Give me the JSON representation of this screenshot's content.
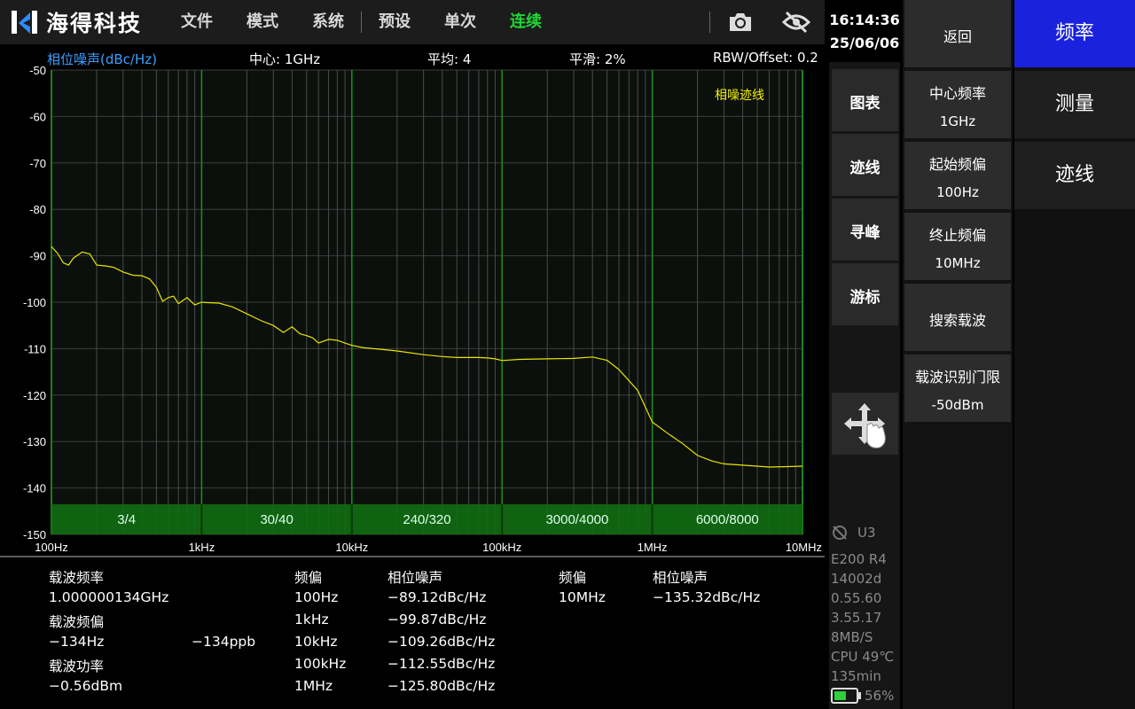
{
  "app": {
    "logo_text": "海得科技",
    "menu": [
      {
        "label": "文件",
        "active": false
      },
      {
        "label": "模式",
        "active": false
      },
      {
        "label": "系统",
        "active": false
      },
      {
        "label": "预设",
        "active": false
      },
      {
        "label": "单次",
        "active": false
      },
      {
        "label": "连续",
        "active": true
      }
    ],
    "icons": [
      "camera-icon",
      "eye-off-icon"
    ]
  },
  "info": {
    "unit": "相位噪声(dBc/Hz)",
    "center": "中心: 1GHz",
    "average": "平均: 4",
    "smooth": "平滑: 2%",
    "rbw": "RBW/Offset: 0.2"
  },
  "chart_data": {
    "type": "line",
    "title": "",
    "xscale": "log",
    "xlim": [
      100,
      10000000
    ],
    "ylim": [
      -150,
      -50
    ],
    "yticks": [
      -50,
      -60,
      -70,
      -80,
      -90,
      -100,
      -110,
      -120,
      -130,
      -140,
      -150
    ],
    "xtick_labels": [
      "100Hz",
      "1kHz",
      "10kHz",
      "100kHz",
      "1MHz",
      "10MHz"
    ],
    "legend": "相噪迹线",
    "legend_color": "#f2f200",
    "grid": true,
    "band_labels": [
      "3/4",
      "30/40",
      "240/320",
      "3000/4000",
      "6000/8000"
    ],
    "series": [
      {
        "name": "相噪迹线",
        "x": [
          100,
          110,
          120,
          130,
          140,
          160,
          180,
          200,
          230,
          260,
          300,
          350,
          400,
          450,
          500,
          550,
          600,
          650,
          700,
          800,
          900,
          1000,
          1100,
          1300,
          1600,
          2000,
          2500,
          3000,
          3500,
          4000,
          4500,
          5000,
          5500,
          6000,
          7000,
          8000,
          9000,
          10000,
          12000,
          15000,
          20000,
          30000,
          40000,
          50000,
          60000,
          70000,
          80000,
          90000,
          100000,
          130000,
          200000,
          300000,
          400000,
          500000,
          600000,
          800000,
          1000000,
          1300000,
          1600000,
          2000000,
          2500000,
          3000000,
          4000000,
          5000000,
          6000000,
          8000000,
          10000000
        ],
        "y": [
          -88,
          -89.5,
          -91.5,
          -92,
          -90.5,
          -89.2,
          -89.6,
          -92,
          -92.2,
          -92.5,
          -93.5,
          -94.2,
          -94.3,
          -95,
          -96.8,
          -99.8,
          -99,
          -98.7,
          -100.3,
          -99,
          -100.6,
          -100,
          -100.1,
          -100.2,
          -101,
          -102.5,
          -104,
          -105,
          -106.5,
          -105.3,
          -106.8,
          -107.2,
          -107.7,
          -108.8,
          -108,
          -108.2,
          -108.8,
          -109.3,
          -109.8,
          -110.1,
          -110.5,
          -111.3,
          -111.7,
          -111.9,
          -111.9,
          -111.9,
          -112.0,
          -112.2,
          -112.55,
          -112.3,
          -112.2,
          -112.1,
          -111.8,
          -112.5,
          -114.5,
          -119,
          -125.8,
          -128.5,
          -130.5,
          -133,
          -134.2,
          -134.8,
          -135.1,
          -135.3,
          -135.5,
          -135.4,
          -135.3
        ],
        "color": "#e6e600"
      }
    ]
  },
  "measurements": {
    "carrier_freq_label": "载波频率",
    "carrier_freq_value": "1.000000134GHz",
    "carrier_offset_label": "载波频偏",
    "carrier_offset_value": "−134Hz",
    "carrier_offset_ppb": "−134ppb",
    "carrier_power_label": "载波功率",
    "carrier_power_value": "−0.56dBm",
    "col_header_offset": "频偏",
    "col_header_noise": "相位噪声",
    "rows": [
      {
        "offset": "100Hz",
        "noise": "−89.12dBc/Hz"
      },
      {
        "offset": "1kHz",
        "noise": "−99.87dBc/Hz"
      },
      {
        "offset": "10kHz",
        "noise": "−109.26dBc/Hz"
      },
      {
        "offset": "100kHz",
        "noise": "−112.55dBc/Hz"
      },
      {
        "offset": "1MHz",
        "noise": "−125.80dBc/Hz"
      }
    ],
    "rows2": [
      {
        "offset": "10MHz",
        "noise": "−135.32dBc/Hz"
      }
    ]
  },
  "status": {
    "time": "16:14:36",
    "date": "25/06/06",
    "u3": "U3",
    "model": "E200 R4",
    "serial": "14002d",
    "ver1": "0.55.60",
    "ver2": "3.55.17",
    "rate": "8MB/S",
    "cpu": "CPU 49℃",
    "runtime": "135min",
    "battery": "56%",
    "battery_level": 0.56
  },
  "col1": [
    "图表",
    "迹线",
    "寻峰",
    "游标"
  ],
  "col2": {
    "back": "返回",
    "center_label": "中心频率",
    "center_value": "1GHz",
    "start_label": "起始频偏",
    "start_value": "100Hz",
    "stop_label": "终止频偏",
    "stop_value": "10MHz",
    "search": "搜索载波",
    "thresh_label": "载波识别门限",
    "thresh_value": "-50dBm"
  },
  "col3": [
    {
      "label": "频率",
      "active": true
    },
    {
      "label": "测量",
      "active": false
    },
    {
      "label": "迹线",
      "active": false
    }
  ]
}
